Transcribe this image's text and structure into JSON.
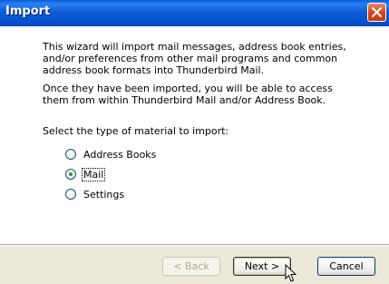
{
  "window": {
    "title": "Import"
  },
  "intro": {
    "paragraph1": "This wizard will import mail messages, address book entries, and/or preferences from other mail programs and common address book formats into Thunderbird Mail.",
    "paragraph2": "Once they have been imported, you will be able to access them from within Thunderbird Mail and/or Address Book."
  },
  "prompt": "Select the type of material to import:",
  "options": [
    {
      "label": "Address Books",
      "selected": false
    },
    {
      "label": "Mail",
      "selected": true
    },
    {
      "label": "Settings",
      "selected": false
    }
  ],
  "buttons": {
    "back": "< Back",
    "next": "Next >",
    "cancel": "Cancel"
  },
  "colors": {
    "titlebar": "#0353d0",
    "close_button": "#d6451f",
    "radio_dot": "#21a121"
  }
}
